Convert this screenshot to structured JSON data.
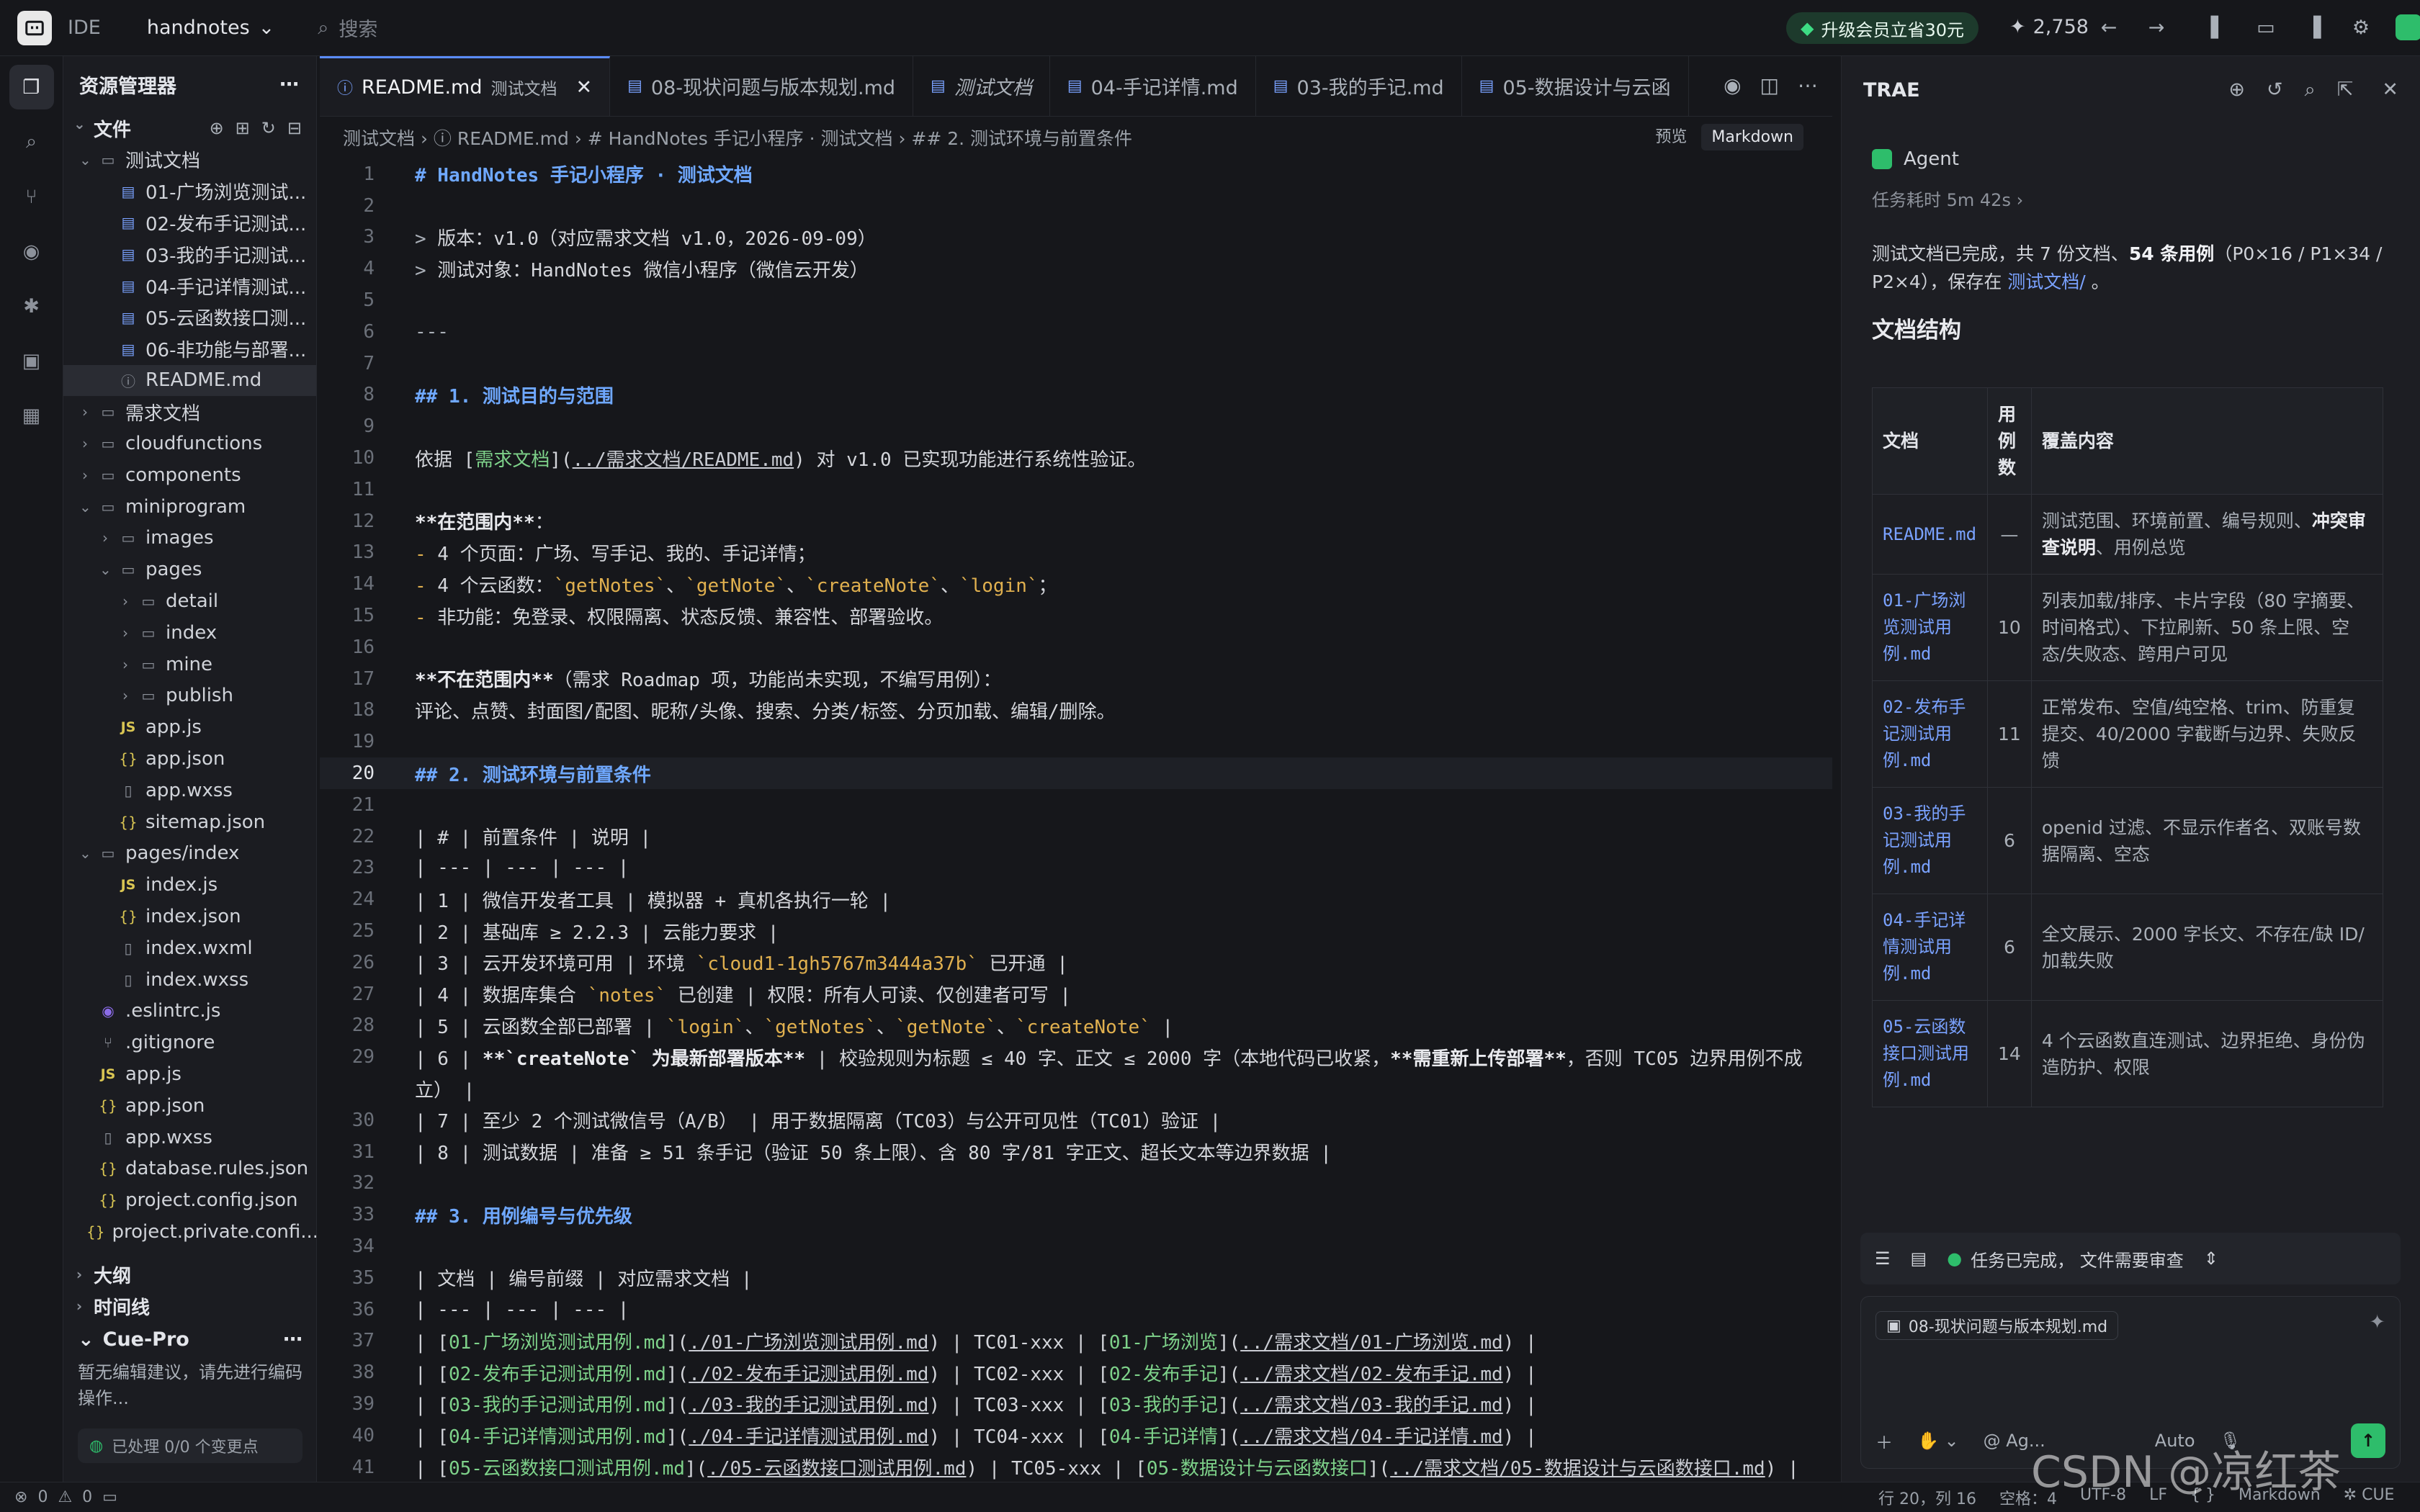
{
  "titlebar": {
    "mode": "IDE",
    "project": "handnotes",
    "search_placeholder": "搜索",
    "upgrade": "升级会员立省30元",
    "stars": "2,758"
  },
  "activity": [
    "explorer-icon",
    "search-icon",
    "source-control-icon",
    "preview-icon",
    "debug-icon",
    "remote-icon",
    "extensions-icon"
  ],
  "sidebar": {
    "title": "资源管理器",
    "files_section": "文件",
    "tree": [
      {
        "label": "测试文档",
        "indent": 1,
        "caret": "⌄",
        "icon": "folder"
      },
      {
        "label": "01-广场浏览测试...",
        "indent": 2,
        "icon": "md"
      },
      {
        "label": "02-发布手记测试...",
        "indent": 2,
        "icon": "md"
      },
      {
        "label": "03-我的手记测试...",
        "indent": 2,
        "icon": "md"
      },
      {
        "label": "04-手记详情测试...",
        "indent": 2,
        "icon": "md"
      },
      {
        "label": "05-云函数接口测...",
        "indent": 2,
        "icon": "md"
      },
      {
        "label": "06-非功能与部署...",
        "indent": 2,
        "icon": "md"
      },
      {
        "label": "README.md",
        "indent": 2,
        "icon": "info",
        "selected": true
      },
      {
        "label": "需求文档",
        "indent": 1,
        "caret": "›",
        "icon": "folder"
      },
      {
        "label": "cloudfunctions",
        "indent": 1,
        "caret": "›",
        "icon": "folder"
      },
      {
        "label": "components",
        "indent": 1,
        "caret": "›",
        "icon": "folder"
      },
      {
        "label": "miniprogram",
        "indent": 1,
        "caret": "⌄",
        "icon": "folder"
      },
      {
        "label": "images",
        "indent": 2,
        "caret": "›",
        "icon": "folder"
      },
      {
        "label": "pages",
        "indent": 2,
        "caret": "⌄",
        "icon": "folder"
      },
      {
        "label": "detail",
        "indent": 3,
        "caret": "›",
        "icon": "folder"
      },
      {
        "label": "index",
        "indent": 3,
        "caret": "›",
        "icon": "folder"
      },
      {
        "label": "mine",
        "indent": 3,
        "caret": "›",
        "icon": "folder"
      },
      {
        "label": "publish",
        "indent": 3,
        "caret": "›",
        "icon": "folder"
      },
      {
        "label": "app.js",
        "indent": 2,
        "icon": "js"
      },
      {
        "label": "app.json",
        "indent": 2,
        "icon": "json"
      },
      {
        "label": "app.wxss",
        "indent": 2,
        "icon": "file"
      },
      {
        "label": "sitemap.json",
        "indent": 2,
        "icon": "json"
      },
      {
        "label": "pages/index",
        "indent": 1,
        "caret": "⌄",
        "icon": "folder"
      },
      {
        "label": "index.js",
        "indent": 2,
        "icon": "js"
      },
      {
        "label": "index.json",
        "indent": 2,
        "icon": "json"
      },
      {
        "label": "index.wxml",
        "indent": 2,
        "icon": "file"
      },
      {
        "label": "index.wxss",
        "indent": 2,
        "icon": "file"
      },
      {
        "label": ".eslintrc.js",
        "indent": 1,
        "icon": "lint"
      },
      {
        "label": ".gitignore",
        "indent": 1,
        "icon": "git"
      },
      {
        "label": "app.js",
        "indent": 1,
        "icon": "js"
      },
      {
        "label": "app.json",
        "indent": 1,
        "icon": "json"
      },
      {
        "label": "app.wxss",
        "indent": 1,
        "icon": "file"
      },
      {
        "label": "database.rules.json",
        "indent": 1,
        "icon": "json"
      },
      {
        "label": "project.config.json",
        "indent": 1,
        "icon": "json"
      },
      {
        "label": "project.private.confi...",
        "indent": 1,
        "icon": "json"
      }
    ],
    "outline": "大纲",
    "timeline": "时间线",
    "cuepro_title": "Cue-Pro",
    "cuepro_desc": "暂无编辑建议，请先进行编码操作...",
    "cuepro_footer": "已处理 0/0 个变更点"
  },
  "tabs": [
    {
      "label": "README.md",
      "suffix": "测试文档",
      "active": true
    },
    {
      "label": "08-现状问题与版本规划.md"
    },
    {
      "label": "测试文档",
      "italic": true
    },
    {
      "label": "04-手记详情.md"
    },
    {
      "label": "03-我的手记.md"
    },
    {
      "label": "05-数据设计与云函"
    }
  ],
  "breadcrumb": "测试文档 › ⓘ README.md › # HandNotes 手记小程序 · 测试文档 › ## 2. 测试环境与前置条件",
  "editor_right": {
    "preview": "预览",
    "lang": "Markdown"
  },
  "code": [
    {
      "n": "1",
      "html": "<span class='h'># HandNotes 手记小程序 · 测试文档</span>"
    },
    {
      "n": "2",
      "html": ""
    },
    {
      "n": "3",
      "html": "<span class='q'>&gt;</span> 版本：v1.0（对应需求文档 v1.0，2026-09-09）"
    },
    {
      "n": "4",
      "html": "<span class='q'>&gt;</span> 测试对象：HandNotes 微信小程序（微信云开发）"
    },
    {
      "n": "5",
      "html": ""
    },
    {
      "n": "6",
      "html": "<span class='q'>---</span>"
    },
    {
      "n": "7",
      "html": ""
    },
    {
      "n": "8",
      "html": "<span class='h'>## 1. 测试目的与范围</span>"
    },
    {
      "n": "9",
      "html": ""
    },
    {
      "n": "10",
      "html": "依据 [<span class='lk'>需求文档</span>](<span class='url'>../需求文档/README.md</span>) 对 v1.0 已实现功能进行系统性验证。"
    },
    {
      "n": "11",
      "html": ""
    },
    {
      "n": "12",
      "html": "<span class='b'>**在范围内**</span>："
    },
    {
      "n": "13",
      "html": "<span class='bul'>-</span> 4 个页面：广场、写手记、我的、手记详情；"
    },
    {
      "n": "14",
      "html": "<span class='bul'>-</span> 4 个云函数：<span class='cd'>`getNotes`</span>、<span class='cd'>`getNote`</span>、<span class='cd'>`createNote`</span>、<span class='cd'>`login`</span>；"
    },
    {
      "n": "15",
      "html": "<span class='bul'>-</span> 非功能：免登录、权限隔离、状态反馈、兼容性、部署验收。"
    },
    {
      "n": "16",
      "html": ""
    },
    {
      "n": "17",
      "html": "<span class='b'>**不在范围内**</span>（需求 Roadmap 项，功能尚未实现，不编写用例）："
    },
    {
      "n": "18",
      "html": "评论、点赞、封面图/配图、昵称/头像、搜索、分类/标签、分页加载、编辑/删除。"
    },
    {
      "n": "19",
      "html": ""
    },
    {
      "n": "20",
      "html": "<span class='h'>## 2. 测试环境与前置条件</span>",
      "cur": true
    },
    {
      "n": "21",
      "html": ""
    },
    {
      "n": "22",
      "html": "| # | 前置条件 | 说明 |"
    },
    {
      "n": "23",
      "html": "| --- | --- | --- |"
    },
    {
      "n": "24",
      "html": "| 1 | 微信开发者工具 | 模拟器 + 真机各执行一轮 |"
    },
    {
      "n": "25",
      "html": "| 2 | 基础库 ≥ 2.2.3 | 云能力要求 |"
    },
    {
      "n": "26",
      "html": "| 3 | 云开发环境可用 | 环境 <span class='cd'>`cloud1-1gh5767m3444a37b`</span> 已开通 |"
    },
    {
      "n": "27",
      "html": "| 4 | 数据库集合 <span class='cd'>`notes`</span> 已创建 | 权限：所有人可读、仅创建者可写 |"
    },
    {
      "n": "28",
      "html": "| 5 | 云函数全部已部署 | <span class='cd'>`login`</span>、<span class='cd'>`getNotes`</span>、<span class='cd'>`getNote`</span>、<span class='cd'>`createNote`</span> |"
    },
    {
      "n": "29",
      "html": "| 6 | <span class='b'>**`createNote` 为最新部署版本**</span> | 校验规则为标题 ≤ 40 字、正文 ≤ 2000 字（本地代码已收紧，<span class='b'>**需重新上传部署**</span>，否则 TC05 边界用例不成"
    },
    {
      "n": "",
      "html": "立） |"
    },
    {
      "n": "30",
      "html": "| 7 | 至少 2 个测试微信号（A/B） | 用于数据隔离（TC03）与公开可见性（TC01）验证 |"
    },
    {
      "n": "31",
      "html": "| 8 | 测试数据 | 准备 ≥ 51 条手记（验证 50 条上限）、含 80 字/81 字正文、超长文本等边界数据 |"
    },
    {
      "n": "32",
      "html": ""
    },
    {
      "n": "33",
      "html": "<span class='h'>## 3. 用例编号与优先级</span>"
    },
    {
      "n": "34",
      "html": ""
    },
    {
      "n": "35",
      "html": "| 文档 | 编号前缀 | 对应需求文档 |"
    },
    {
      "n": "36",
      "html": "| --- | --- | --- |"
    },
    {
      "n": "37",
      "html": "| [<span class='lk'>01-广场浏览测试用例.md</span>](<span class='url'>./01-广场浏览测试用例.md</span>) | TC01-xxx | [<span class='lk'>01-广场浏览</span>](<span class='url'>../需求文档/01-广场浏览.md</span>) |"
    },
    {
      "n": "38",
      "html": "| [<span class='lk'>02-发布手记测试用例.md</span>](<span class='url'>./02-发布手记测试用例.md</span>) | TC02-xxx | [<span class='lk'>02-发布手记</span>](<span class='url'>../需求文档/02-发布手记.md</span>) |"
    },
    {
      "n": "39",
      "html": "| [<span class='lk'>03-我的手记测试用例.md</span>](<span class='url'>./03-我的手记测试用例.md</span>) | TC03-xxx | [<span class='lk'>03-我的手记</span>](<span class='url'>../需求文档/03-我的手记.md</span>) |"
    },
    {
      "n": "40",
      "html": "| [<span class='lk'>04-手记详情测试用例.md</span>](<span class='url'>./04-手记详情测试用例.md</span>) | TC04-xxx | [<span class='lk'>04-手记详情</span>](<span class='url'>../需求文档/04-手记详情.md</span>) |"
    },
    {
      "n": "41",
      "html": "| [<span class='lk'>05-云函数接口测试用例.md</span>](<span class='url'>./05-云函数接口测试用例.md</span>) | TC05-xxx | [<span class='lk'>05-数据设计与云函数接口</span>](<span class='url'>../需求文档/05-数据设计与云函数接口.md</span>) |"
    }
  ],
  "ai": {
    "title": "TRAE",
    "agent": "Agent",
    "elapsed": "任务耗时 5m 42s ›",
    "summary_html": "测试文档已完成，共 7 份文档、<b>54 条用例</b>（P0×16 / P1×34 / P2×4），保存在 <span class='lkt'>测试文档/</span> 。",
    "doc_struct": "文档结构",
    "table_head": [
      "文档",
      "用例数",
      "覆盖内容"
    ],
    "rows": [
      {
        "doc": "README.md",
        "n": "—",
        "cover_html": "测试范围、环境前置、编号规则、<b>冲突审查说明</b>、用例总览"
      },
      {
        "doc": "01-广场浏览测试用例.md",
        "n": "10",
        "cover_html": "列表加载/排序、卡片字段（80 字摘要、时间格式）、下拉刷新、50 条上限、空态/失败态、跨用户可见"
      },
      {
        "doc": "02-发布手记测试用例.md",
        "n": "11",
        "cover_html": "正常发布、空值/纯空格、trim、防重复提交、40/2000 字截断与边界、失败反馈"
      },
      {
        "doc": "03-我的手记测试用例.md",
        "n": "6",
        "cover_html": "openid 过滤、不显示作者名、双账号数据隔离、空态"
      },
      {
        "doc": "04-手记详情测试用例.md",
        "n": "6",
        "cover_html": "全文展示、2000 字长文、不存在/缺 ID/加载失败"
      },
      {
        "doc": "05-云函数接口测试用例.md",
        "n": "14",
        "cover_html": "4 个云函数直连测试、边界拒绝、身份伪造防护、权限"
      }
    ],
    "status": "任务已完成，  文件需要审查",
    "chip": "08-现状问题与版本规划.md",
    "mention": "@ Ag...",
    "mode": "Auto"
  },
  "statusbar": {
    "errors": "0",
    "warnings": "0",
    "position": "行 20，列 16",
    "spaces": "空格：4",
    "encoding": "UTF-8",
    "eol": "LF",
    "braces": "{ }",
    "lang": "Markdown",
    "cue": "✲ CUE"
  },
  "watermark": "CSDN @凉红茶"
}
